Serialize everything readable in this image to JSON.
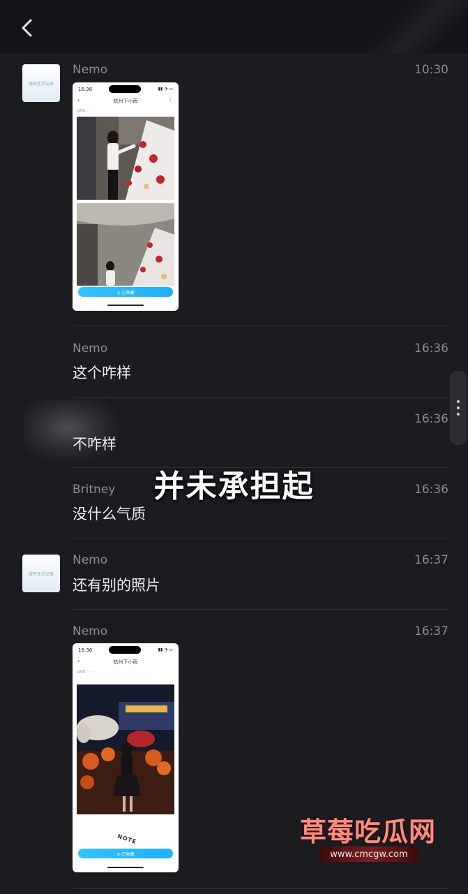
{
  "header": {
    "back_icon": "chevron-left-icon"
  },
  "messages": [
    {
      "sender": "Nemo",
      "time": "10:30",
      "type": "image",
      "screenshot": {
        "status_time": "16:36",
        "nav_title": "杭州下小雨",
        "meta": "@四1  ·  ·  ·",
        "action_label": "◎ 已收藏"
      }
    },
    {
      "sender": "Nemo",
      "time": "16:36",
      "text": "这个咋样"
    },
    {
      "sender": "",
      "time": "16:36",
      "text": "不咋样"
    },
    {
      "sender": "Britney",
      "time": "16:36",
      "text": "没什么气质"
    },
    {
      "sender": "Nemo",
      "time": "16:37",
      "text": "还有别的照片"
    },
    {
      "sender": "Nemo",
      "time": "16:37",
      "type": "image",
      "screenshot": {
        "status_time": "16:36",
        "nav_title": "杭州下小雨",
        "meta": "@四1  ·  ·  ·",
        "stamp": "NOTE",
        "action_label": "◎ 已收藏"
      }
    }
  ],
  "overlay": {
    "caption": "并未承担起"
  },
  "watermark": {
    "title": "草莓吃瓜网",
    "url": "www.cmcgw.com"
  },
  "avatar": {
    "label": "城市生活记录"
  },
  "colors": {
    "background": "#1c1b20",
    "accent": "#20b0f5",
    "watermark": "#ff8b7f"
  }
}
